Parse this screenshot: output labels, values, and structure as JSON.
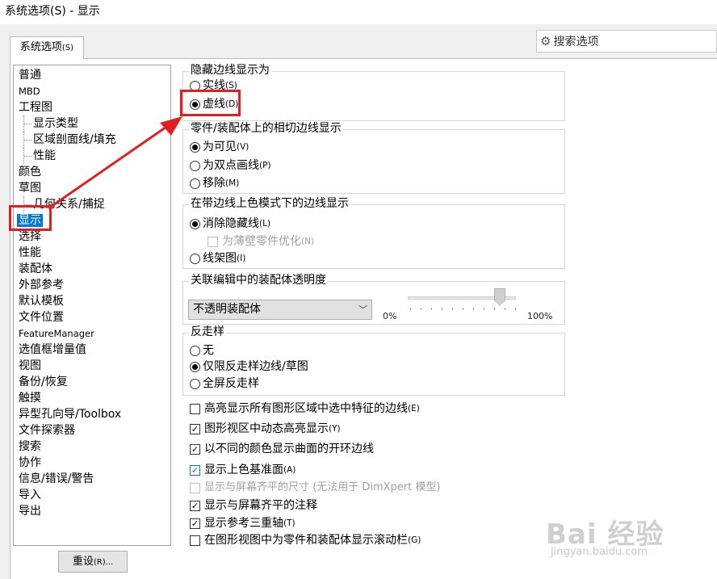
{
  "window": {
    "title": "系统选项(S) - 显示"
  },
  "tab": {
    "label": "系统选项",
    "shortcut": "(S)"
  },
  "search": {
    "placeholder": "搜索选项"
  },
  "tree": {
    "items": [
      {
        "label": "普通"
      },
      {
        "label": "MBD"
      },
      {
        "label": "工程图"
      },
      {
        "label": "显示类型"
      },
      {
        "label": "区域剖面线/填充"
      },
      {
        "label": "性能"
      },
      {
        "label": "颜色"
      },
      {
        "label": "草图"
      },
      {
        "label": "几何关系/捕捉"
      },
      {
        "label": "显示"
      },
      {
        "label": "选择"
      },
      {
        "label": "性能"
      },
      {
        "label": "装配体"
      },
      {
        "label": "外部参考"
      },
      {
        "label": "默认模板"
      },
      {
        "label": "文件位置"
      },
      {
        "label": "FeatureManager"
      },
      {
        "label": "选值框增量值"
      },
      {
        "label": "视图"
      },
      {
        "label": "备份/恢复"
      },
      {
        "label": "触摸"
      },
      {
        "label": "异型孔向导/Toolbox"
      },
      {
        "label": "文件探索器"
      },
      {
        "label": "搜索"
      },
      {
        "label": "协作"
      },
      {
        "label": "信息/错误/警告"
      },
      {
        "label": "导入"
      },
      {
        "label": "导出"
      }
    ],
    "selected": "显示"
  },
  "reset_button": {
    "label": "重设",
    "shortcut": "(R)..."
  },
  "hidden_edges": {
    "title": "隐藏边线显示为",
    "options": [
      {
        "label": "实线",
        "shortcut": "(S)",
        "selected": false
      },
      {
        "label": "虚线",
        "shortcut": "(D)",
        "selected": true
      }
    ]
  },
  "tangent_edges": {
    "title": "零件/装配体上的相切边线显示",
    "options": [
      {
        "label": "为可见",
        "shortcut": "(V)",
        "selected": true
      },
      {
        "label": "为双点画线",
        "shortcut": "(P)",
        "selected": false
      },
      {
        "label": "移除",
        "shortcut": "(M)",
        "selected": false
      }
    ]
  },
  "shaded_edges": {
    "title": "在带边线上色模式下的边线显示",
    "options": [
      {
        "label": "消除隐藏线",
        "shortcut": "(L)",
        "selected": true
      },
      {
        "label": "线架图",
        "shortcut": "(I)",
        "selected": false
      }
    ],
    "thin_wall": {
      "label": "为薄壁零件优化",
      "shortcut": "(N)",
      "checked": false,
      "disabled": true
    }
  },
  "transparency": {
    "title": "关联编辑中的装配体透明度",
    "dropdown_value": "不透明装配体",
    "min_label": "0%",
    "max_label": "100%",
    "slider_level_percent": 85
  },
  "antialias": {
    "title": "反走样",
    "options": [
      {
        "label": "无",
        "selected": false
      },
      {
        "label": "仅限反走样边线/草图",
        "selected": true
      },
      {
        "label": "全屏反走样",
        "selected": false
      }
    ]
  },
  "checkboxes": [
    {
      "label": "高亮显示所有图形区域中选中特征的边线",
      "shortcut": "(E)",
      "checked": false,
      "disabled": false
    },
    {
      "label": "图形视区中动态高亮显示",
      "shortcut": "(Y)",
      "checked": true,
      "disabled": false
    },
    {
      "label": "以不同的颜色显示曲面的开环边线",
      "shortcut": "",
      "checked": true,
      "disabled": false
    },
    {
      "label": "显示上色基准面",
      "shortcut": "(A)",
      "checked": true,
      "disabled": false
    },
    {
      "label": "显示与屏幕齐平的尺寸 (无法用于 DimXpert 模型)",
      "shortcut": "",
      "checked": false,
      "disabled": true
    },
    {
      "label": "显示与屏幕齐平的注释",
      "shortcut": "",
      "checked": true,
      "disabled": false
    },
    {
      "label": "显示参考三重轴",
      "shortcut": "(T)",
      "checked": true,
      "disabled": false
    },
    {
      "label": "在图形视图中为零件和装配体显示滚动栏",
      "shortcut": "(G)",
      "checked": false,
      "disabled": false
    }
  ],
  "watermark": {
    "text": "Bai 经验",
    "sub": "jingyan.baidu.com"
  },
  "colors": {
    "accent": "#0078d7",
    "annotation": "#e02020"
  }
}
